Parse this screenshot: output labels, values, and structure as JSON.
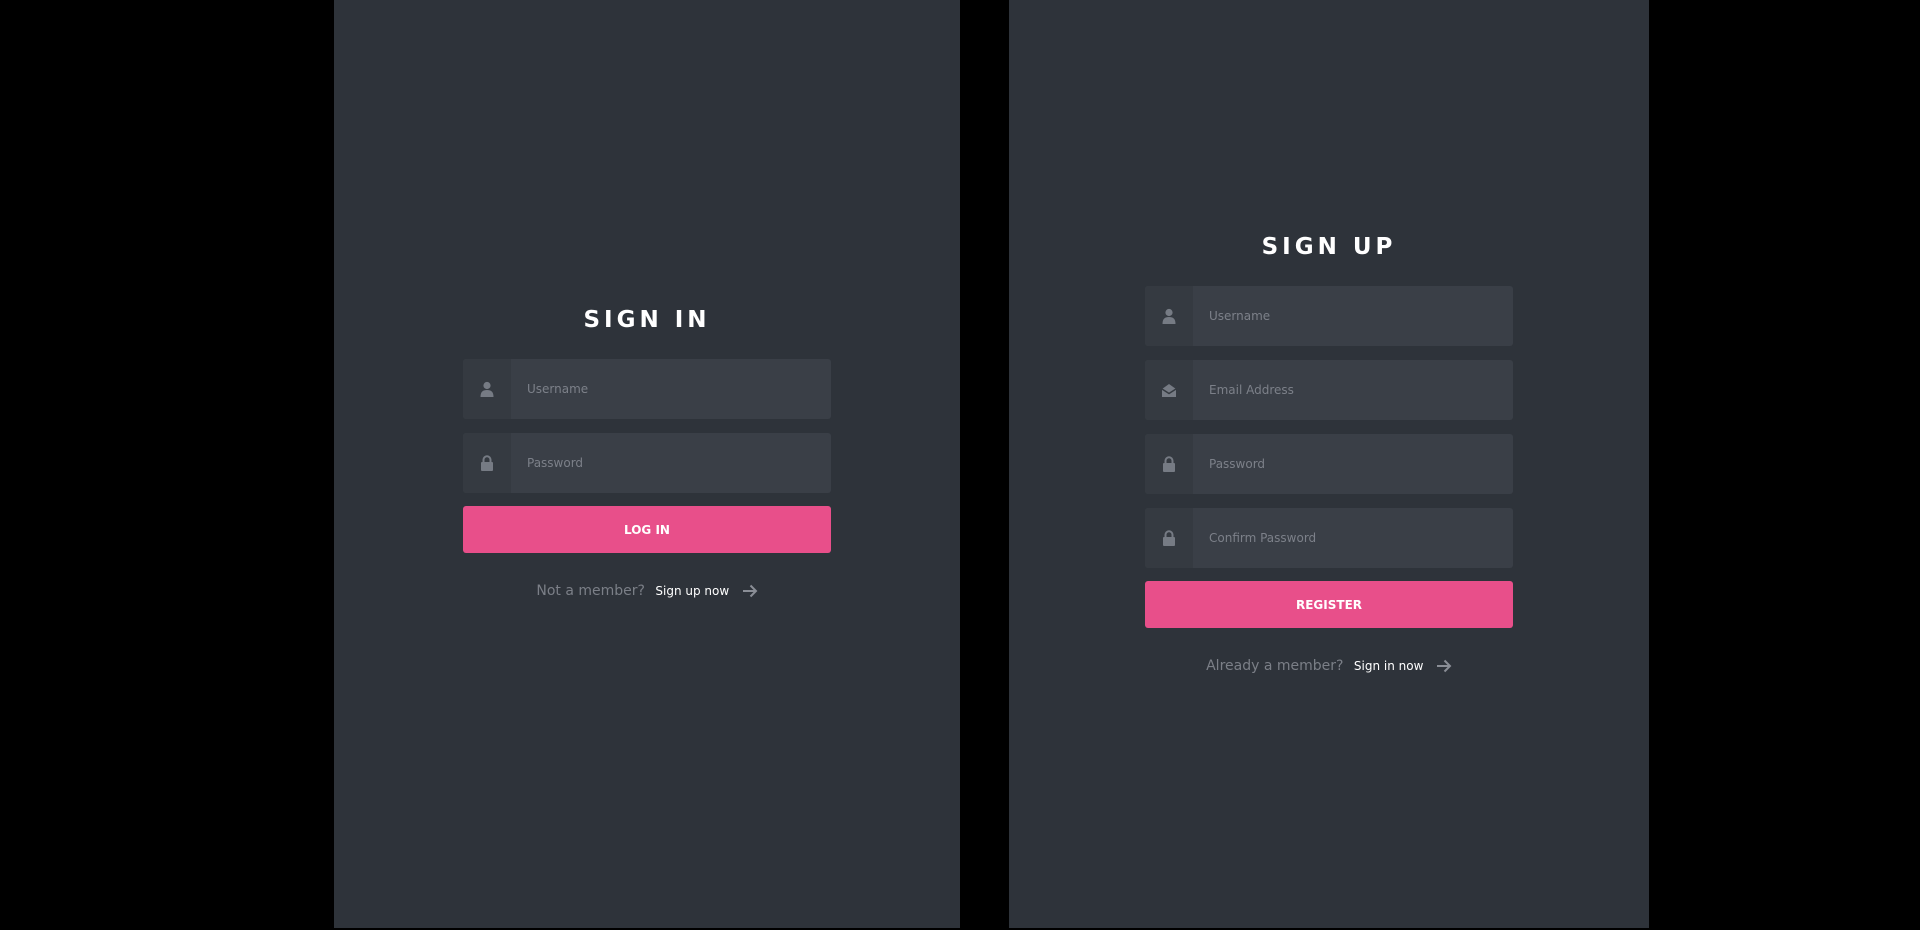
{
  "signin": {
    "title": "SIGN IN",
    "username_placeholder": "Username",
    "password_placeholder": "Password",
    "button_label": "LOG IN",
    "prompt_text": "Not a member?",
    "link_text": "Sign up now",
    "icons": [
      "user-icon",
      "lock-icon",
      "arrow-right-icon"
    ]
  },
  "signup": {
    "title": "SIGN UP",
    "username_placeholder": "Username",
    "email_placeholder": "Email Address",
    "password_placeholder": "Password",
    "confirm_placeholder": "Confirm Password",
    "button_label": "REGISTER",
    "prompt_text": "Already a member?",
    "link_text": "Sign in now",
    "icons": [
      "user-icon",
      "envelope-open-icon",
      "lock-icon",
      "arrow-right-icon"
    ]
  },
  "colors": {
    "page_background": "#000000",
    "panel_background": "#2e333a",
    "field_background": "#3a3f47",
    "icon_background": "#353a41",
    "accent": "#e84f8a",
    "muted_text": "#7b7f87"
  }
}
